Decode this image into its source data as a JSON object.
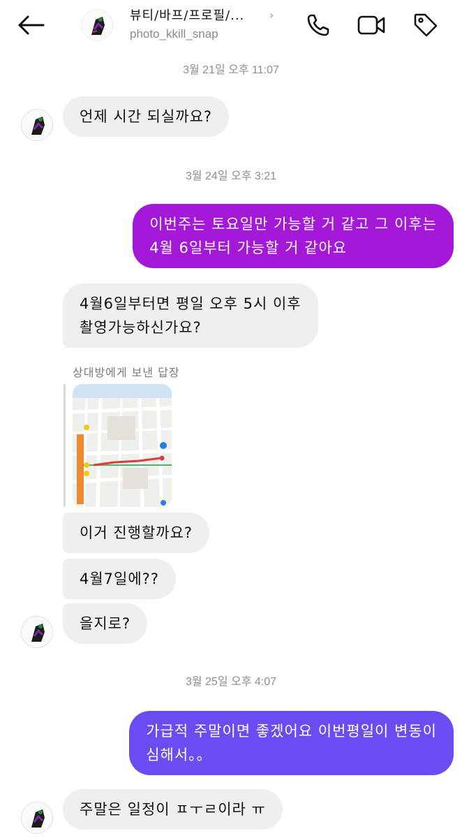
{
  "header": {
    "title": "뷰티/바프/프로필/...",
    "username": "photo_kkill_snap"
  },
  "colors": {
    "outgoing_purple": "#a419d8",
    "outgoing_violet": "#6a4cf0",
    "incoming_gray": "#efefef",
    "timestamp_gray": "#8e8e8e"
  },
  "icons": [
    "back-arrow-icon",
    "chevron-right-icon",
    "phone-icon",
    "video-camera-icon",
    "tag-icon"
  ],
  "messages": {
    "ts1": "3월 21일 오후 11:07",
    "m1": "언제 시간 되실까요?",
    "ts2": "3월 24일 오후 3:21",
    "m2_line1": "이번주는 토요일만 가능할 거 같고 그 이후는",
    "m2_line2": "4월 6일부터 가능할 거 같아요",
    "m3_line1": "4월6일부터면 평일 오후 5시 이후",
    "m3_line2": "촬영가능하신가요?",
    "reply_label": "상대방에게 보낸 답장",
    "m4": "이거 진행할까요?",
    "m5": "4월7일에??",
    "m6": "을지로?",
    "ts3": "3월 25일 오후 4:07",
    "m7_line1": "가급적 주말이면 좋겠어요 이번평일이 변동이",
    "m7_line2": "심해서。。",
    "m8": "주말은 일정이 ㅍㅜㄹ이라 ㅠ"
  }
}
